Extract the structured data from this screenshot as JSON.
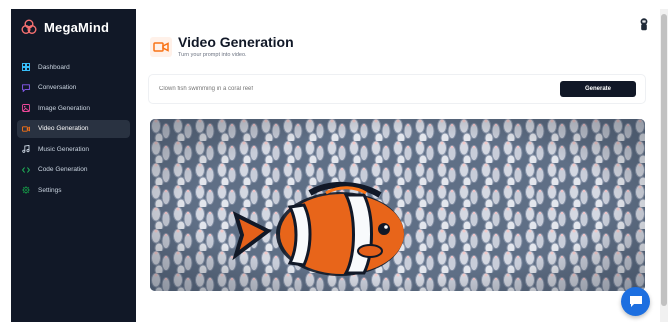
{
  "brand": {
    "name": "MegaMind",
    "logo_icon": "triple-circles-logo-icon",
    "logo_color": "#f87171"
  },
  "sidebar": {
    "items": [
      {
        "label": "Dashboard",
        "icon": "grid-icon",
        "color": "#38bdf8",
        "active": false
      },
      {
        "label": "Conversation",
        "icon": "chat-bubble-icon",
        "color": "#8b5cf6",
        "active": false
      },
      {
        "label": "Image Generation",
        "icon": "image-icon",
        "color": "#ec4899",
        "active": false
      },
      {
        "label": "Video Generation",
        "icon": "video-camera-icon",
        "color": "#f97316",
        "active": true
      },
      {
        "label": "Music Generation",
        "icon": "music-note-icon",
        "color": "#cbd5e1",
        "active": false
      },
      {
        "label": "Code Generation",
        "icon": "code-brackets-icon",
        "color": "#22c55e",
        "active": false
      },
      {
        "label": "Settings",
        "icon": "gear-icon",
        "color": "#16a34a",
        "active": false
      }
    ]
  },
  "header": {
    "title": "Video Generation",
    "subtitle": "Turn your prompt into video.",
    "icon": "video-camera-icon",
    "icon_color": "#f97316",
    "icon_bg": "#fff1e9"
  },
  "prompt": {
    "value": "",
    "placeholder": "Clown fish swimming in a coral reef",
    "button_label": "Generate"
  },
  "video": {
    "content": "clownfish-in-anemone"
  },
  "user_button": {
    "icon": "user-avatar-icon"
  },
  "chat_widget": {
    "icon": "chat-bubble-icon",
    "color": "#1d6fe0"
  }
}
